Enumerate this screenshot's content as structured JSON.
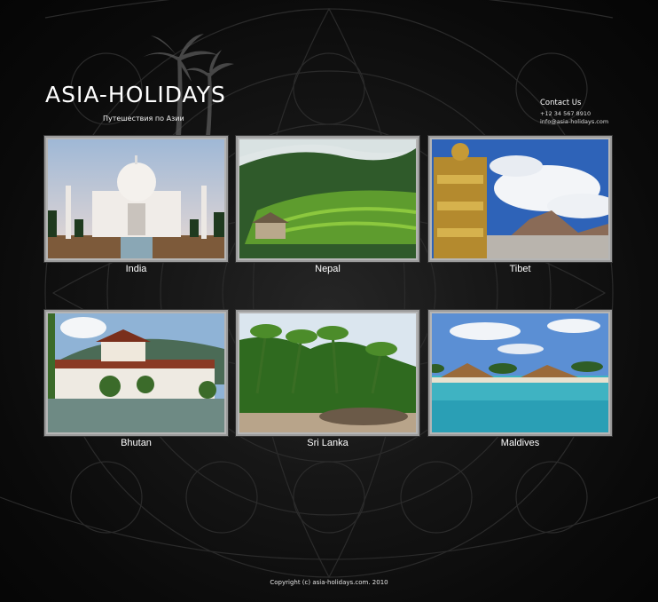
{
  "header": {
    "logo_text": "ASIA-HOLIDAYS",
    "tagline": "Путешествия по Азии"
  },
  "contact": {
    "title": "Contact Us",
    "phone": "+12 34 567 8910",
    "email": "info@asia-holidays.com"
  },
  "destinations": [
    {
      "label": "India"
    },
    {
      "label": "Nepal"
    },
    {
      "label": "Tibet"
    },
    {
      "label": "Bhutan"
    },
    {
      "label": "Sri Lanka"
    },
    {
      "label": "Maldives"
    }
  ],
  "footer": {
    "copyright": "Copyright (c) asia-holidays.com. 2010"
  },
  "colors": {
    "background": "#0c0c0c",
    "frame": "#9b9b9b",
    "text": "#ffffff"
  }
}
